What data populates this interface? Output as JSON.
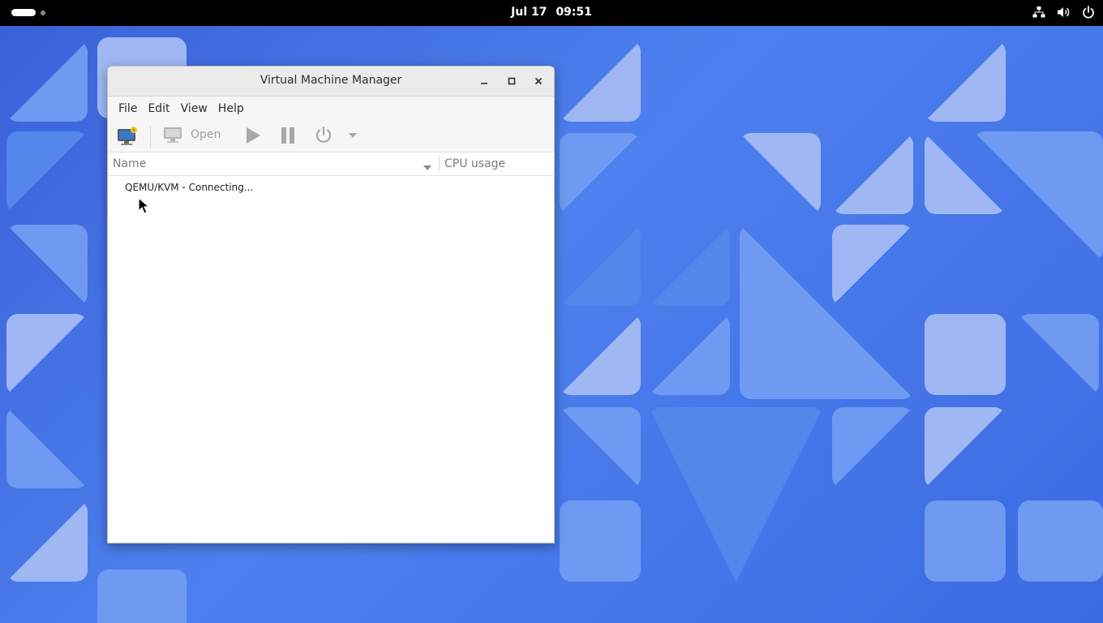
{
  "topbar": {
    "date": "Jul 17",
    "time": "09:51",
    "tray_icons": [
      "network-icon",
      "volume-icon",
      "power-icon"
    ]
  },
  "window": {
    "title": "Virtual Machine Manager",
    "menu": [
      "File",
      "Edit",
      "View",
      "Help"
    ],
    "toolbar": {
      "new_vm_icon": "new-vm-icon",
      "open_label": "Open",
      "run_icon": "play-icon",
      "pause_icon": "pause-icon",
      "shutdown_icon": "power-icon"
    },
    "columns": {
      "name": "Name",
      "cpu": "CPU usage"
    },
    "rows": [
      {
        "label": "QEMU/KVM - Connecting..."
      }
    ]
  },
  "colors": {
    "topbar_bg": "#000000",
    "wallpaper_blue": "#4d80ee",
    "window_bg": "#ffffff",
    "headerbar_bg": "#ebebeb"
  }
}
